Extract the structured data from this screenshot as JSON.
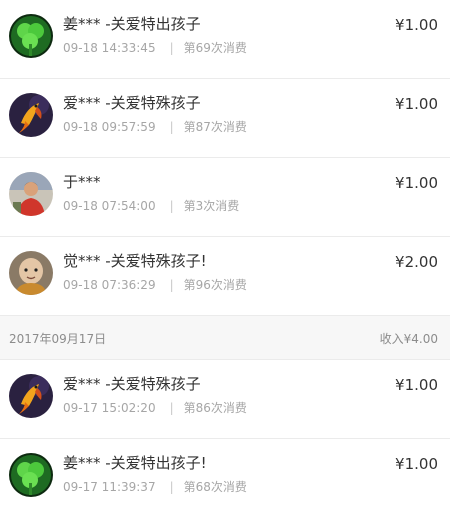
{
  "transactions_top": [
    {
      "name": "姜*** -关爱特出孩子",
      "time": "09-18 14:33:45",
      "sep": "|",
      "count": "第69次消费",
      "amount": "¥1.00",
      "avatar": "green-clover-icon"
    },
    {
      "name": "爱*** -关爱特殊孩子",
      "time": "09-18 09:57:59",
      "sep": "|",
      "count": "第87次消费",
      "amount": "¥1.00",
      "avatar": "goldfish-icon"
    },
    {
      "name": "于***",
      "time": "09-18 07:54:00",
      "sep": "|",
      "count": "第3次消费",
      "amount": "¥1.00",
      "avatar": "person-photo-icon"
    },
    {
      "name": "觉*** -关爱特殊孩子!",
      "time": "09-18 07:36:29",
      "sep": "|",
      "count": "第96次消费",
      "amount": "¥2.00",
      "avatar": "monk-face-icon"
    }
  ],
  "day_header": {
    "date": "2017年09月17日",
    "income": "收入¥4.00"
  },
  "transactions_bottom": [
    {
      "name": "爱*** -关爱特殊孩子",
      "time": "09-17 15:02:20",
      "sep": "|",
      "count": "第86次消费",
      "amount": "¥1.00",
      "avatar": "goldfish-icon"
    },
    {
      "name": "姜*** -关爱特出孩子!",
      "time": "09-17 11:39:37",
      "sep": "|",
      "count": "第68次消费",
      "amount": "¥1.00",
      "avatar": "green-clover-icon"
    }
  ],
  "colors": {
    "text": "#333333",
    "meta": "#a6a6a6",
    "divider": "#ebebeb",
    "header_bg": "#f7f7f7"
  }
}
